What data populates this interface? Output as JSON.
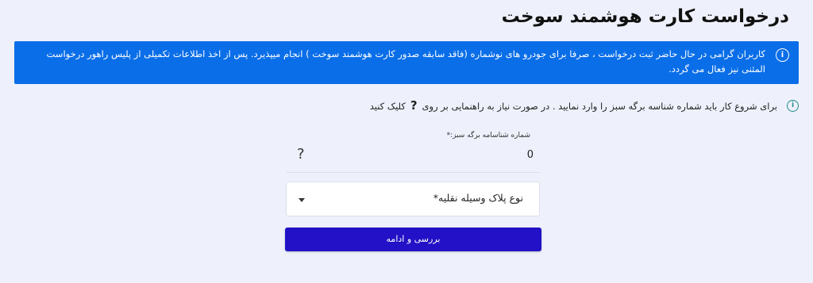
{
  "page": {
    "title": "درخواست کارت هوشمند سوخت"
  },
  "info_banner": {
    "icon": "info-icon",
    "icon_glyph": "i",
    "text": "کاربران گرامی در حال حاضر ثبت درخواست ، صرفا برای جودرو های نوشماره (فاقد سابقه صدور کارت هوشمند سوخت ) انجام میپذیرد. پس از اخذ اطلاعات تکمیلی از پلیس راهور درخواست المثنی نیز فعال می گردد.",
    "background_color": "#0a6ee8"
  },
  "hint": {
    "icon": "info-circle-icon",
    "icon_glyph": "i",
    "text_before": "برای شروع کار باید شماره شناسه برگه سبز را وارد نمایید . در صورت نیاز به راهنمایی بر روی",
    "question_mark": "?",
    "text_after": "کلیک کنید"
  },
  "form": {
    "serial_field": {
      "label": "شماره شناسامه برگه سبز:*",
      "value": "0",
      "help_icon": "question-mark-icon",
      "help_glyph": "?"
    },
    "plate_select": {
      "selected": "نوع پلاک وسیله نقلیه*",
      "arrow_icon": "caret-down-icon"
    },
    "submit_label": "بررسی و ادامه",
    "submit_color": "#2211c6"
  }
}
